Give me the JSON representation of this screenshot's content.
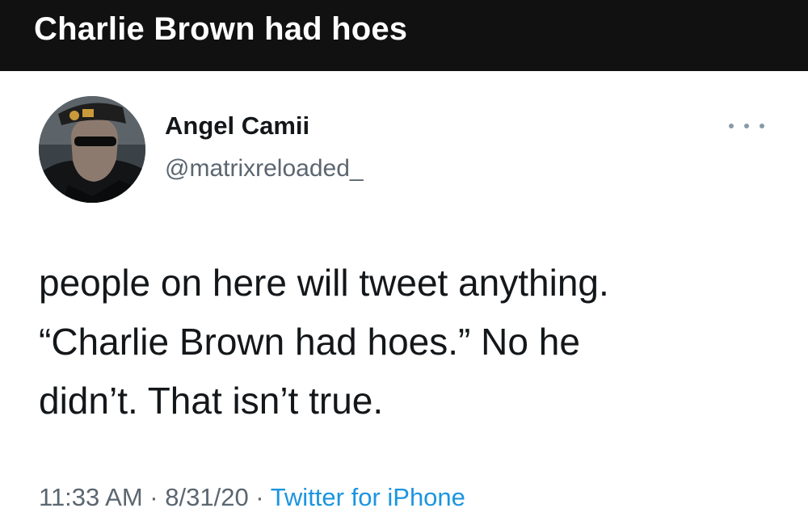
{
  "header": {
    "title": "Charlie Brown had hoes"
  },
  "tweet": {
    "display_name": "Angel Camii",
    "handle": "@matrixreloaded_",
    "more_icon": "more-options-icon",
    "text_lines": [
      "people on here will tweet anything.",
      "“Charlie Brown had hoes.” No he",
      "didn’t. That isn’t true."
    ],
    "time": "11:33 AM",
    "date": "8/31/20",
    "separator": " · ",
    "source": "Twitter for iPhone"
  },
  "colors": {
    "header_bg": "#111111",
    "header_text": "#ffffff",
    "text_primary": "#14171a",
    "text_secondary": "#5b6670",
    "link_blue": "#1b95e0"
  }
}
